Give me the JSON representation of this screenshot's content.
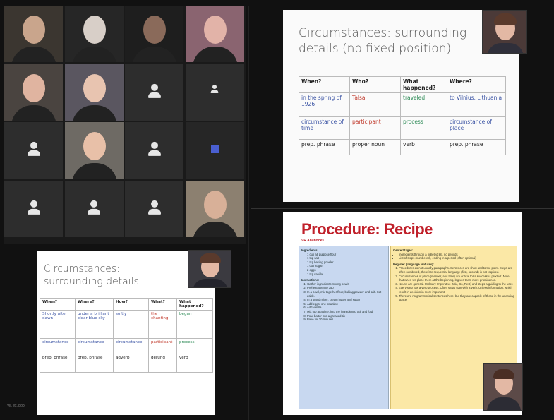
{
  "gallery": {
    "tiles": [
      {
        "label": "",
        "kind": "video",
        "bg": "#3b3630",
        "skin": "#c9a58c"
      },
      {
        "label": "",
        "kind": "video",
        "bg": "#262626",
        "skin": "#d8cfc8"
      },
      {
        "label": "",
        "kind": "video",
        "bg": "#1e1e1e",
        "skin": "#8a6a5a"
      },
      {
        "label": "",
        "kind": "video",
        "bg": "#8a6470",
        "skin": "#e2b3a8"
      },
      {
        "label": "",
        "kind": "video",
        "bg": "#4a4440",
        "skin": "#e0b4a0"
      },
      {
        "label": "",
        "kind": "video",
        "bg": "#5a5660",
        "skin": "#e8c4b0"
      },
      {
        "label": "",
        "kind": "avatar"
      },
      {
        "label": "",
        "kind": "avatar-small"
      },
      {
        "label": "",
        "kind": "avatar"
      },
      {
        "label": "",
        "kind": "video",
        "bg": "#6e6a64",
        "skin": "#e8c0a8"
      },
      {
        "label": "",
        "kind": "avatar"
      },
      {
        "label": "",
        "kind": "shared"
      },
      {
        "label": "",
        "kind": "avatar"
      },
      {
        "label": "",
        "kind": "avatar"
      },
      {
        "label": "",
        "kind": "avatar"
      },
      {
        "label": "",
        "kind": "video",
        "bg": "#8c8070",
        "skin": "#d8b098"
      }
    ]
  },
  "slide1": {
    "title": "Circumstances: surrounding details (no fixed position)",
    "headers": [
      "When?",
      "Who?",
      "What happened?",
      "Where?"
    ],
    "rows": [
      [
        {
          "t": "in the spring of 1926",
          "c": "c-blue"
        },
        {
          "t": "Talsa",
          "c": "c-red"
        },
        {
          "t": "traveled",
          "c": "c-green"
        },
        {
          "t": "to Vilnius, Lithuania",
          "c": "c-blue"
        }
      ],
      [
        {
          "t": "circumstance of time",
          "c": "c-blue"
        },
        {
          "t": "participant",
          "c": "c-red"
        },
        {
          "t": "process",
          "c": "c-green"
        },
        {
          "t": "circumstance of place",
          "c": "c-blue"
        }
      ],
      [
        {
          "t": "prep. phrase",
          "c": "c-black"
        },
        {
          "t": "proper noun",
          "c": "c-black"
        },
        {
          "t": "verb",
          "c": "c-black"
        },
        {
          "t": "prep. phrase",
          "c": "c-black"
        }
      ]
    ]
  },
  "slide2": {
    "title": "Circumstances: surrounding details",
    "headers": [
      "When?",
      "Where?",
      "How?",
      "What?",
      "What happened?"
    ],
    "rows": [
      [
        {
          "t": "Shortly after dawn",
          "c": "c-blue"
        },
        {
          "t": "under a brilliant clear blue sky",
          "c": "c-blue"
        },
        {
          "t": "softly",
          "c": "c-blue"
        },
        {
          "t": "the chanting",
          "c": "c-red"
        },
        {
          "t": "began",
          "c": "c-green"
        }
      ],
      [
        {
          "t": "circumstance",
          "c": "c-blue"
        },
        {
          "t": "circumstance",
          "c": "c-blue"
        },
        {
          "t": "circumstance",
          "c": "c-blue"
        },
        {
          "t": "participant",
          "c": "c-red"
        },
        {
          "t": "process",
          "c": "c-green"
        }
      ],
      [
        {
          "t": "prep. phrase",
          "c": "c-black"
        },
        {
          "t": "prep. phrase",
          "c": "c-black"
        },
        {
          "t": "adverb",
          "c": "c-black"
        },
        {
          "t": "gerund",
          "c": "c-black"
        },
        {
          "t": "verb",
          "c": "c-black"
        }
      ]
    ]
  },
  "recipe": {
    "title": "Procedure: Recipe",
    "subtitle": "VR Anaflocks",
    "left_heading": "Ingredients:",
    "ingredients": [
      "1 cup all purpose flour",
      "1 tsp salt",
      "1 tsp baking powder",
      "1 cup sugar",
      "2 eggs",
      "1 tsp vanilla"
    ],
    "method_heading": "Instructions:",
    "steps": [
      "Gather ingredients mixing bowls",
      "Preheat oven to 350",
      "In a bowl, mix together flour, baking powder and salt. Set aside.",
      "In a stand mixer, cream butter and sugar",
      "Add eggs, one at a time",
      "Add vanilla",
      "Mix top at a time, into the ingredients. Stir and fold.",
      "Pour batter into a greased tin",
      "Bake for 30 minutes."
    ],
    "right_heading": "Genre Stages:",
    "stages": [
      "Ingredients through a bulleted list, no periods",
      "List of steps (numbered), ending in a period (often optional)"
    ],
    "features_heading": "Register (language features):",
    "features": [
      "Procedures do not usually paragraphs. Sentences are short and to the point. Steps are often numbered, therefore sequential language (first, second) is not required.",
      "Circumstances of place (manner, and time) are critical for a successful product. Note that when we place them at the beginning, it gives them more prominence.",
      "Nouns are general. Ordinary Imperative (Mix, Go, Rest) and steps a guiding to the user.",
      "Every step has a verb process. Often steps start with a verb. Unless information, which result in decision in more important.",
      "There are no grammatical sentences here, but they are capable of those in the unending space."
    ]
  },
  "bottom_left_label": "Vil. ex. pop"
}
